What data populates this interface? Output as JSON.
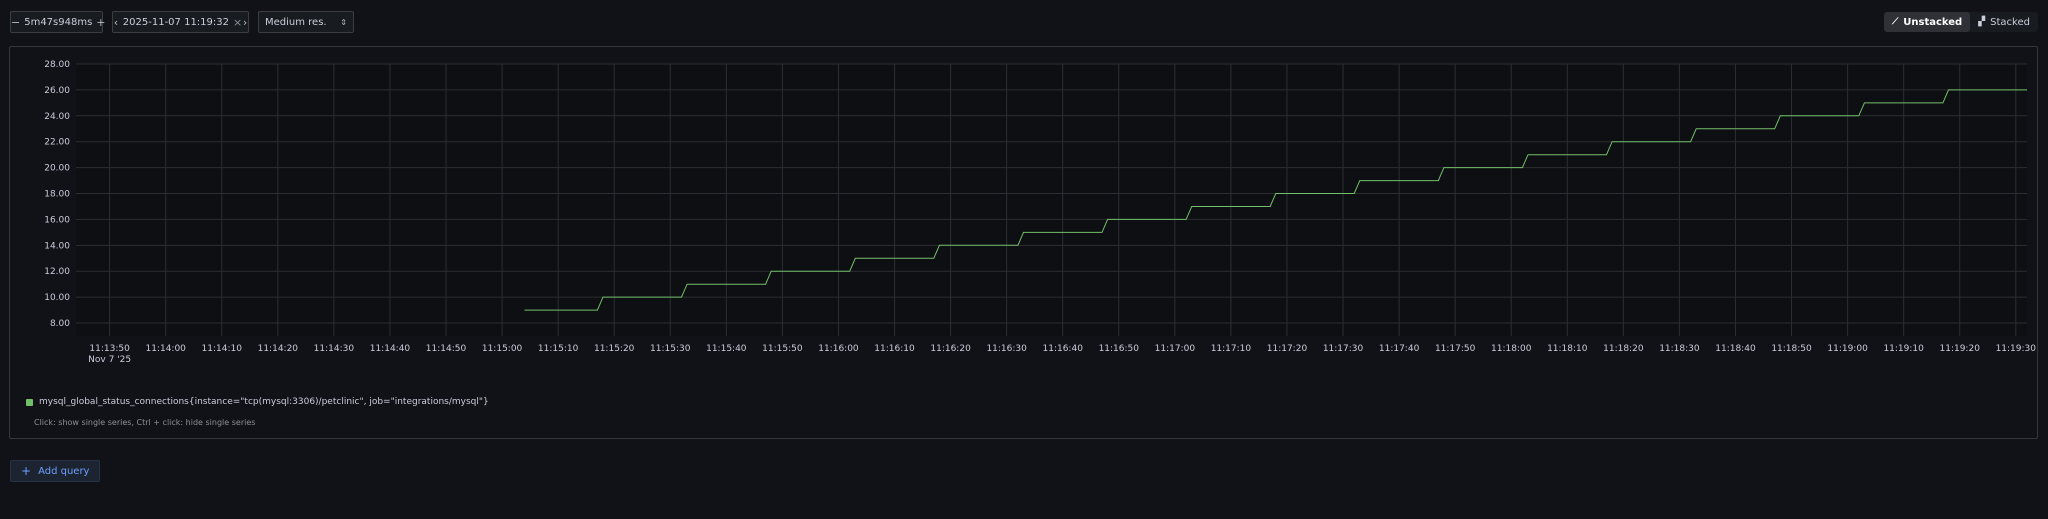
{
  "toolbar": {
    "step_value": "5m47s948ms",
    "time_value": "2025-11-07 11:19:32",
    "resolution": "Medium res.",
    "unstacked_label": "Unstacked",
    "stacked_label": "Stacked"
  },
  "legend": {
    "series_name": "mysql_global_status_connections{instance=\"tcp(mysql:3306)/petclinic\", job=\"integrations/mysql\"}",
    "hint": "Click: show single series, Ctrl + click: hide single series",
    "color": "#73bf69"
  },
  "add_query_label": "Add query",
  "chart_data": {
    "type": "line",
    "x_ticks": [
      "11:13:50",
      "11:14:00",
      "11:14:10",
      "11:14:20",
      "11:14:30",
      "11:14:40",
      "11:14:50",
      "11:15:00",
      "11:15:10",
      "11:15:20",
      "11:15:30",
      "11:15:40",
      "11:15:50",
      "11:16:00",
      "11:16:10",
      "11:16:20",
      "11:16:30",
      "11:16:40",
      "11:16:50",
      "11:17:00",
      "11:17:10",
      "11:17:20",
      "11:17:30",
      "11:17:40",
      "11:17:50",
      "11:18:00",
      "11:18:10",
      "11:18:20",
      "11:18:30",
      "11:18:40",
      "11:18:50",
      "11:19:00",
      "11:19:10",
      "11:19:20",
      "11:19:30"
    ],
    "x_date_label": "Nov 7 '25",
    "y_ticks": [
      "8.00",
      "10.00",
      "12.00",
      "14.00",
      "16.00",
      "18.00",
      "20.00",
      "22.00",
      "24.00",
      "26.00",
      "28.00"
    ],
    "xlim": [
      "11:13:44",
      "11:19:32"
    ],
    "ylim": [
      7,
      28
    ],
    "grid": true,
    "series": [
      {
        "color": "#73bf69",
        "points": [
          [
            "11:15:04",
            9
          ],
          [
            "11:15:17",
            9
          ],
          [
            "11:15:18",
            10
          ],
          [
            "11:15:32",
            10
          ],
          [
            "11:15:33",
            11
          ],
          [
            "11:15:47",
            11
          ],
          [
            "11:15:48",
            12
          ],
          [
            "11:16:02",
            12
          ],
          [
            "11:16:03",
            13
          ],
          [
            "11:16:17",
            13
          ],
          [
            "11:16:18",
            14
          ],
          [
            "11:16:32",
            14
          ],
          [
            "11:16:33",
            15
          ],
          [
            "11:16:47",
            15
          ],
          [
            "11:16:48",
            16
          ],
          [
            "11:17:02",
            16
          ],
          [
            "11:17:03",
            17
          ],
          [
            "11:17:17",
            17
          ],
          [
            "11:17:18",
            18
          ],
          [
            "11:17:32",
            18
          ],
          [
            "11:17:33",
            19
          ],
          [
            "11:17:47",
            19
          ],
          [
            "11:17:48",
            20
          ],
          [
            "11:18:02",
            20
          ],
          [
            "11:18:03",
            21
          ],
          [
            "11:18:17",
            21
          ],
          [
            "11:18:18",
            22
          ],
          [
            "11:18:32",
            22
          ],
          [
            "11:18:33",
            23
          ],
          [
            "11:18:47",
            23
          ],
          [
            "11:18:48",
            24
          ],
          [
            "11:19:02",
            24
          ],
          [
            "11:19:03",
            25
          ],
          [
            "11:19:17",
            25
          ],
          [
            "11:19:18",
            26
          ],
          [
            "11:19:32",
            26
          ]
        ]
      }
    ]
  }
}
